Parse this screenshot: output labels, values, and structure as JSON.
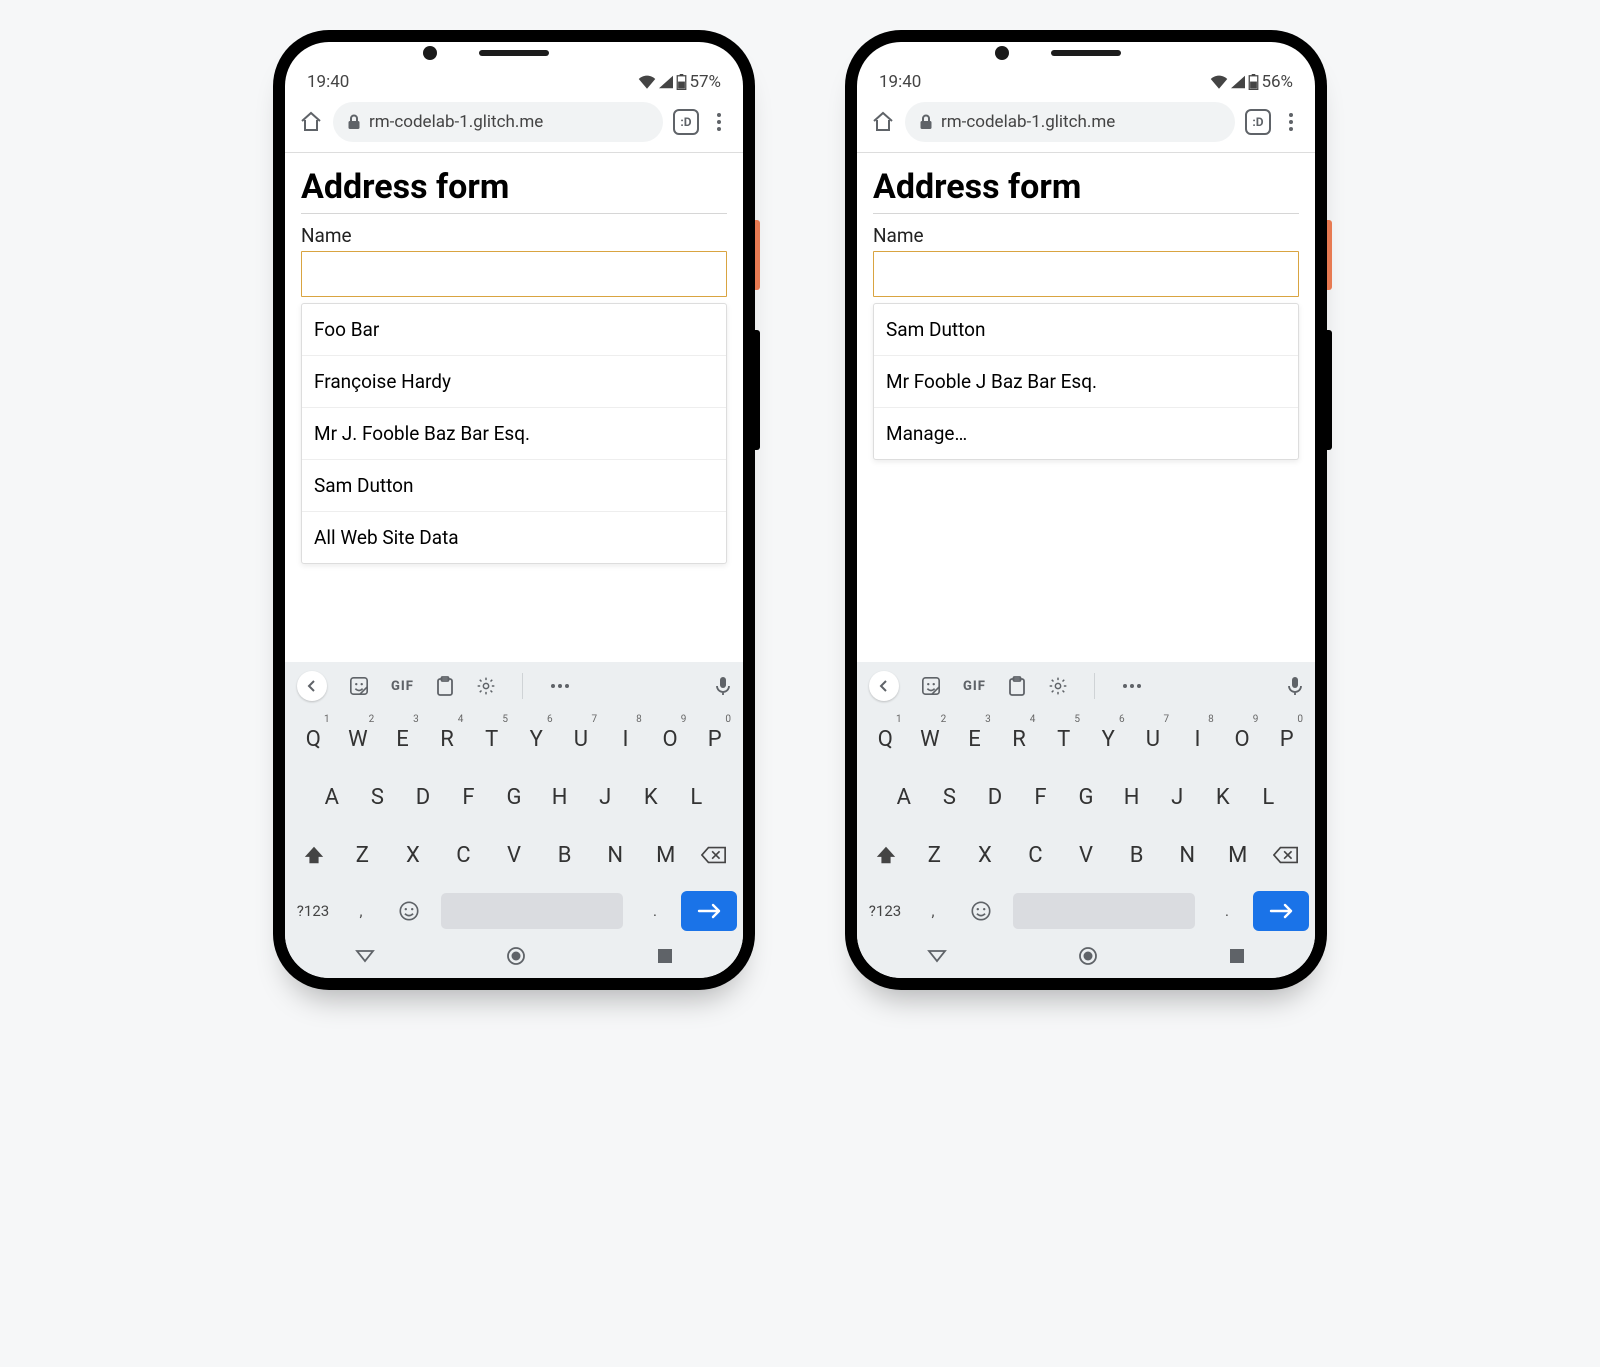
{
  "phones": [
    {
      "status": {
        "time": "19:40",
        "battery": "57%"
      },
      "browser": {
        "url": "rm-codelab-1.glitch.me",
        "tab_count": ":D"
      },
      "page": {
        "title": "Address form",
        "name_label": "Name",
        "name_value": "",
        "suggestions": [
          "Foo Bar",
          "Françoise Hardy",
          "Mr J. Fooble Baz Bar Esq.",
          "Sam Dutton",
          "All Web Site Data"
        ]
      }
    },
    {
      "status": {
        "time": "19:40",
        "battery": "56%"
      },
      "browser": {
        "url": "rm-codelab-1.glitch.me",
        "tab_count": ":D"
      },
      "page": {
        "title": "Address form",
        "name_label": "Name",
        "name_value": "",
        "suggestions": [
          "Sam Dutton",
          "Mr Fooble J Baz Bar Esq.",
          "Manage…"
        ]
      }
    }
  ],
  "keyboard": {
    "toolbar_gif": "GIF",
    "row1": [
      "Q",
      "W",
      "E",
      "R",
      "T",
      "Y",
      "U",
      "I",
      "O",
      "P"
    ],
    "row1_sup": [
      "1",
      "2",
      "3",
      "4",
      "5",
      "6",
      "7",
      "8",
      "9",
      "0"
    ],
    "row2": [
      "A",
      "S",
      "D",
      "F",
      "G",
      "H",
      "J",
      "K",
      "L"
    ],
    "row3": [
      "Z",
      "X",
      "C",
      "V",
      "B",
      "N",
      "M"
    ],
    "sym": "?123",
    "comma": ",",
    "period": "."
  }
}
